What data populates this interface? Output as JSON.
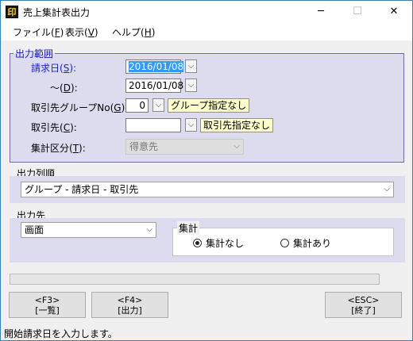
{
  "window": {
    "title": "売上集計表出力",
    "app_icon_glyph": "印",
    "controls": {
      "minimize": "─",
      "maximize": "☐",
      "close": "✕"
    }
  },
  "menu": [
    {
      "label": "ファイル(",
      "key": "F",
      "suffix": ")"
    },
    {
      "label": "表示(",
      "key": "V",
      "suffix": ")"
    },
    {
      "label": "ヘルプ(",
      "key": "H",
      "suffix": ")"
    }
  ],
  "range": {
    "legend": "出力範囲",
    "invoice_from": {
      "label": "請求日(",
      "key": "S",
      "suffix": "):",
      "value": "2016/01/08"
    },
    "invoice_to": {
      "label": "～(",
      "key": "D",
      "suffix": "):",
      "value": "2016/01/08"
    },
    "group_no": {
      "label": "取引先グループNo(",
      "key": "G",
      "suffix": "):",
      "value": "0",
      "hint": "グループ指定なし"
    },
    "customer": {
      "label": "取引先(",
      "key": "C",
      "suffix": "):",
      "value": "",
      "hint": "取引先指定なし"
    },
    "agg_type": {
      "label": "集計区分(",
      "key": "T",
      "suffix": "):",
      "value": "得意先"
    }
  },
  "order": {
    "label": "出力列順",
    "value": "グループ - 請求日 - 取引先"
  },
  "output": {
    "label": "出力先",
    "destination": "画面",
    "total_group": "集計",
    "radio_none": "集計なし",
    "radio_with": "集計あり",
    "selected": "none"
  },
  "fkeys": {
    "f3": {
      "key": "<F3>",
      "label": "[一覧]"
    },
    "f4": {
      "key": "<F4>",
      "label": "[出力]"
    },
    "esc": {
      "key": "<ESC>",
      "label": "[終了]"
    }
  },
  "status_text": "開始請求日を入力します。",
  "colors": {
    "range_panel": "#dcdcee",
    "label_blue": "#2020c8",
    "hint_bg": "#ffffcc"
  }
}
